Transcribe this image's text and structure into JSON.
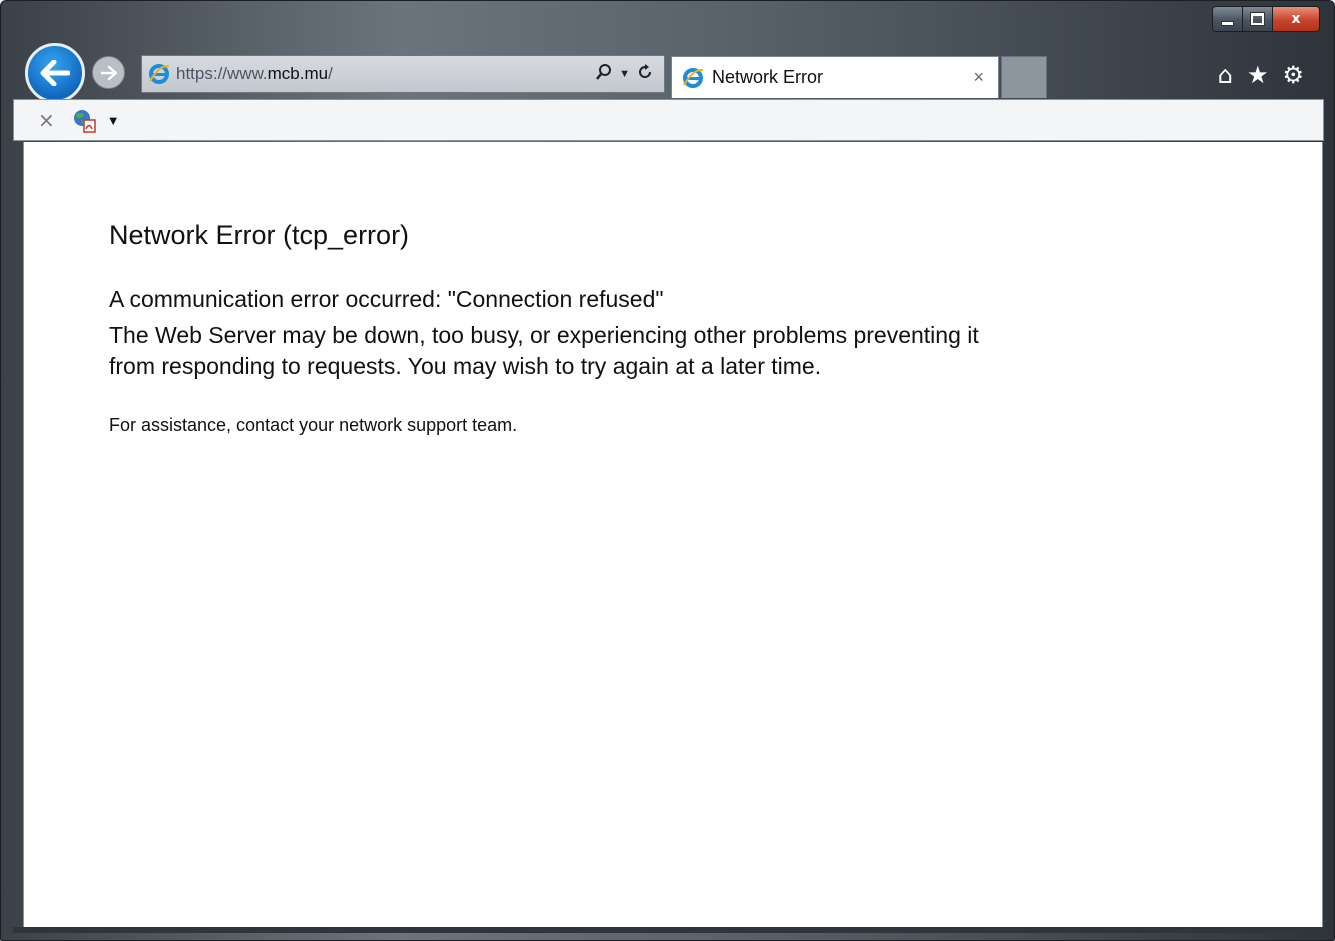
{
  "window": {
    "controls": {
      "minimize": "minimize",
      "maximize": "maximize",
      "close": "x"
    }
  },
  "nav": {
    "back_icon": "back-arrow-icon",
    "forward_icon": "forward-arrow-icon"
  },
  "address": {
    "url_prefix": "https://www.",
    "url_domain": "mcb.mu",
    "url_suffix": "/",
    "search_icon": "search-icon",
    "dropdown_icon": "chevron-down-icon",
    "refresh_icon": "refresh-icon"
  },
  "tab": {
    "title": "Network Error",
    "close": "×"
  },
  "right_icons": {
    "home": "⌂",
    "favorites": "★",
    "tools": "⚙"
  },
  "toolbar": {
    "stop": "×",
    "caret": "▼"
  },
  "page": {
    "title": "Network Error (tcp_error)",
    "message_1": "A communication error occurred: \"Connection refused\"",
    "message_2": "The Web Server may be down, too busy, or experiencing other problems preventing it from responding to requests. You may wish to try again at a later time.",
    "assistance": "For assistance, contact your network support team."
  },
  "colors": {
    "accent": "#1167bf",
    "close_red": "#c8452d"
  }
}
